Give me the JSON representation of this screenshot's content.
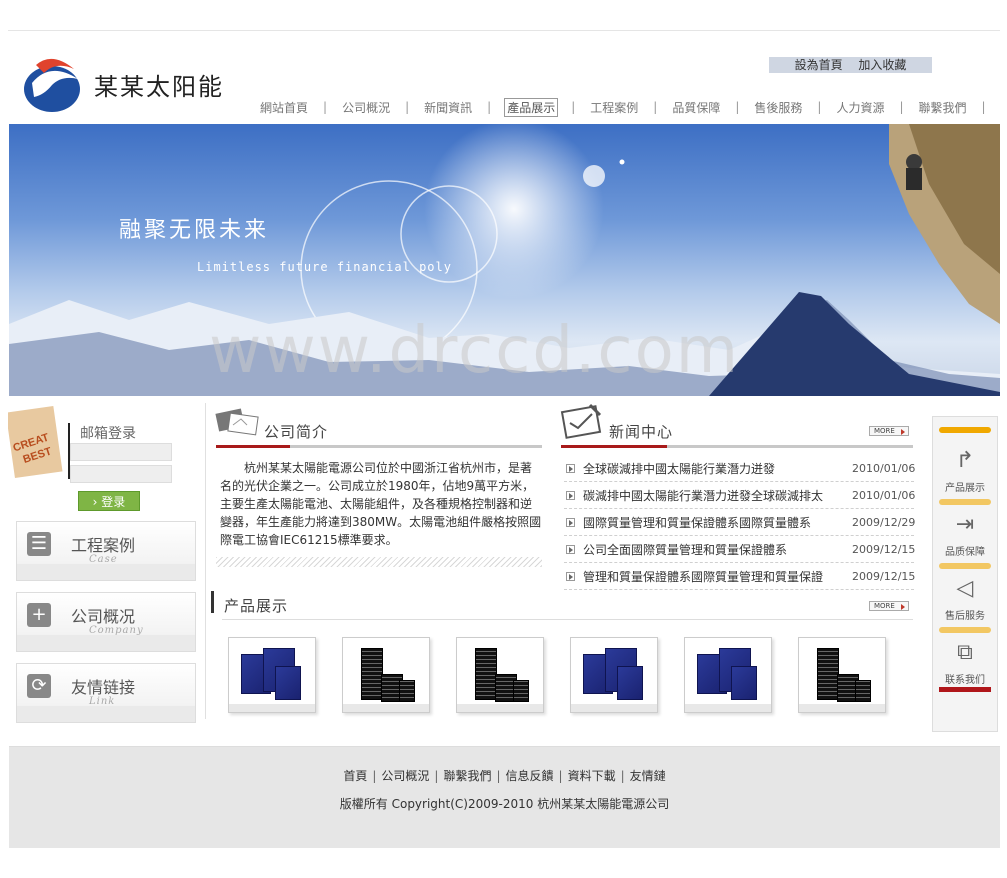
{
  "brand": {
    "name": "某某太阳能"
  },
  "toplinks": {
    "home": "設為首頁",
    "bookmark": "加入收藏"
  },
  "nav": {
    "items": [
      {
        "label": "網站首頁",
        "active": false
      },
      {
        "label": "公司概況",
        "active": false
      },
      {
        "label": "新聞資訊",
        "active": false
      },
      {
        "label": "產品展示",
        "active": true
      },
      {
        "label": "工程案例",
        "active": false
      },
      {
        "label": "品質保障",
        "active": false
      },
      {
        "label": "售後服務",
        "active": false
      },
      {
        "label": "人力資源",
        "active": false
      },
      {
        "label": "聯繫我們",
        "active": false
      }
    ]
  },
  "banner": {
    "slogan": "融聚无限未来",
    "slogan_en": "Limitless future financial poly",
    "watermark": "www.drccd.com"
  },
  "login": {
    "badge": "CREAT BEST",
    "title": "邮箱登录",
    "button": "登录"
  },
  "side_cards": [
    {
      "title": "工程案例",
      "subtitle": "Case",
      "icon": "document-icon"
    },
    {
      "title": "公司概况",
      "subtitle": "Company",
      "icon": "plus-icon"
    },
    {
      "title": "友情链接",
      "subtitle": "Link",
      "icon": "refresh-icon"
    }
  ],
  "about": {
    "title": "公司简介",
    "text": "杭州某某太陽能電源公司位於中國浙江省杭州市，是著名的光伏企業之一。公司成立於1980年，佔地9萬平方米，主要生產太陽能電池、太陽能組件，及各種規格控制器和逆變器，年生產能力將達到380MW。太陽電池組件嚴格按照國際電工協會IEC61215標準要求。"
  },
  "news": {
    "title": "新闻中心",
    "more": "MORE",
    "items": [
      {
        "title": "全球碳減排中國太陽能行業潛力迸發",
        "date": "2010/01/06"
      },
      {
        "title": "碳減排中國太陽能行業潛力迸發全球碳減排太",
        "date": "2010/01/06"
      },
      {
        "title": "國際質量管理和質量保證體系國際質量體系",
        "date": "2009/12/29"
      },
      {
        "title": "公司全面國際質量管理和質量保證體系",
        "date": "2009/12/15"
      },
      {
        "title": "管理和質量保證體系國際質量管理和質量保證",
        "date": "2009/12/15"
      }
    ]
  },
  "products": {
    "title": "产品展示",
    "more": "MORE",
    "items": [
      {
        "type": "blue-panel"
      },
      {
        "type": "black-panel"
      },
      {
        "type": "black-panel"
      },
      {
        "type": "blue-panel"
      },
      {
        "type": "blue-panel"
      },
      {
        "type": "black-panel"
      }
    ]
  },
  "right_services": [
    {
      "label": "产品展示",
      "icon": "arrow-right-icon"
    },
    {
      "label": "品质保障",
      "icon": "login-icon"
    },
    {
      "label": "售后服务",
      "icon": "send-icon"
    },
    {
      "label": "联系我们",
      "icon": "puzzle-icon"
    }
  ],
  "footer": {
    "links": [
      "首頁",
      "公司概況",
      "聯繫我們",
      "信息反饋",
      "資料下載",
      "友情鏈"
    ],
    "copyright": "版權所有 Copyright(C)2009-2010 杭州某某太陽能電源公司"
  },
  "colors": {
    "accent_red": "#a81a1a",
    "login_green": "#7fb545",
    "service_orange": "#f0a800"
  }
}
